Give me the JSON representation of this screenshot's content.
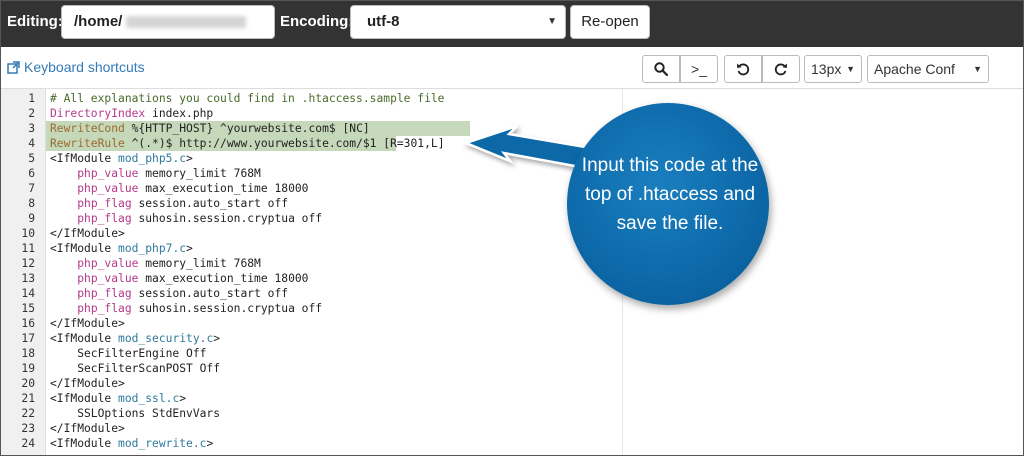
{
  "header": {
    "editing_label": "Editing:",
    "path_value": "/home/",
    "encoding_label": "Encoding:",
    "encoding_value": "utf-8",
    "reopen_label": "Re-open"
  },
  "toolbar": {
    "shortcuts_label": "Keyboard shortcuts",
    "goto_label": ">_",
    "font_size": "13px",
    "mode": "Apache Conf",
    "icons": [
      "search-icon",
      "terminal-icon",
      "undo-icon",
      "redo-icon",
      "external-link-icon"
    ]
  },
  "editor": {
    "lines": [
      {
        "n": "1",
        "t": "# All explanations you could find in .htaccess.sample file"
      },
      {
        "n": "2",
        "t": "DirectoryIndex index.php"
      },
      {
        "n": "3",
        "t": "RewriteCond %{HTTP_HOST} ^yourwebsite.com$ [NC]"
      },
      {
        "n": "4",
        "t": "RewriteRule ^(.*)$ http://www.yourwebsite.com/$1 [R=301,L]"
      },
      {
        "n": "5",
        "t": "<IfModule mod_php5.c>"
      },
      {
        "n": "6",
        "t": "    php_value memory_limit 768M"
      },
      {
        "n": "7",
        "t": "    php_value max_execution_time 18000"
      },
      {
        "n": "8",
        "t": "    php_flag session.auto_start off"
      },
      {
        "n": "9",
        "t": "    php_flag suhosin.session.cryptua off"
      },
      {
        "n": "10",
        "t": "</IfModule>"
      },
      {
        "n": "11",
        "t": "<IfModule mod_php7.c>"
      },
      {
        "n": "12",
        "t": "    php_value memory_limit 768M"
      },
      {
        "n": "13",
        "t": "    php_value max_execution_time 18000"
      },
      {
        "n": "14",
        "t": "    php_flag session.auto_start off"
      },
      {
        "n": "15",
        "t": "    php_flag suhosin.session.cryptua off"
      },
      {
        "n": "16",
        "t": "</IfModule>"
      },
      {
        "n": "17",
        "t": "<IfModule mod_security.c>"
      },
      {
        "n": "18",
        "t": "    SecFilterEngine Off"
      },
      {
        "n": "19",
        "t": "    SecFilterScanPOST Off"
      },
      {
        "n": "20",
        "t": "</IfModule>"
      },
      {
        "n": "21",
        "t": "<IfModule mod_ssl.c>"
      },
      {
        "n": "22",
        "t": "    SSLOptions StdEnvVars"
      },
      {
        "n": "23",
        "t": "</IfModule>"
      },
      {
        "n": "24",
        "t": "<IfModule mod_rewrite.c>"
      }
    ]
  },
  "callout": {
    "text": "Input this code at the top of .htaccess and save the file."
  },
  "colors": {
    "topbar": "#333333",
    "callout": "#0d68a8",
    "highlight": "#c5d9ba",
    "link": "#337ab7"
  }
}
